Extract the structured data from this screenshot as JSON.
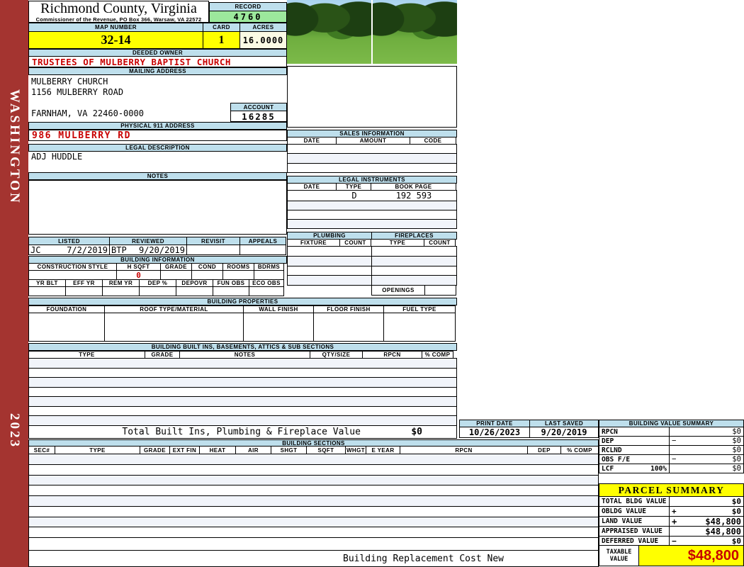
{
  "sidebar": {
    "county_vertical": "WASHINGTON",
    "year": "2023"
  },
  "colors": {
    "sidebar_maroon": "#A43430",
    "header_blue": "#BEDFEC",
    "record_green": "#9CE89C",
    "accent_yellow": "#FFFF00",
    "acres_cream": "#FAFAE4",
    "alert_red": "#C80000"
  },
  "header": {
    "title": "Richmond County, Virginia",
    "subtitle": "Commissioner of the Revenue, PO Box 366, Warsaw, VA 22572",
    "record_label": "RECORD",
    "record_value": "4760",
    "map_number_label": "MAP NUMBER",
    "map_number_value": "32-14",
    "card_label": "CARD",
    "card_value": "1",
    "acres_label": "ACRES",
    "acres_value": "16.0000"
  },
  "owner": {
    "deeded_owner_label": "DEEDED OWNER",
    "deeded_owner": "TRUSTEES OF MULBERRY BAPTIST CHURCH",
    "mailing_address_label": "MAILING ADDRESS",
    "mailing_lines": [
      "MULBERRY CHURCH",
      "1156 MULBERRY ROAD",
      "",
      "FARNHAM, VA 22460-0000"
    ],
    "account_label": "ACCOUNT",
    "account_value": "16285",
    "physical_address_label": "PHYSICAL 911 ADDRESS",
    "physical_address": "986 MULBERRY RD",
    "legal_description_label": "LEGAL DESCRIPTION",
    "legal_description": "ADJ HUDDLE",
    "notes_label": "NOTES",
    "notes": ""
  },
  "review": {
    "listed_label": "LISTED",
    "reviewed_label": "REVIEWED",
    "revisit_label": "REVISIT",
    "appeals_label": "APPEALS",
    "listed_by": "JC",
    "listed_date": "7/2/2019",
    "reviewed_by": "BTP",
    "reviewed_date": "9/20/2019",
    "revisit": "",
    "appeals": ""
  },
  "building_information": {
    "title": "BUILDING INFORMATION",
    "row1_headers": [
      "CONSTRUCTION STYLE",
      "H SQFT",
      "GRADE",
      "COND",
      "ROOMS",
      "BDRMS"
    ],
    "h_sqft_value": "0",
    "row2_headers": [
      "YR BLT",
      "EFF YR",
      "REM YR",
      "DEP %",
      "DEPOVR",
      "FUN OBS",
      "ECO OBS"
    ]
  },
  "building_properties": {
    "title": "BUILDING PROPERTIES",
    "headers": [
      "FOUNDATION",
      "ROOF TYPE/MATERIAL",
      "WALL FINISH",
      "FLOOR FINISH",
      "FUEL TYPE"
    ]
  },
  "built_ins": {
    "title": "BUILDING BUILT INS, BASEMENTS, ATTICS & SUB SECTIONS",
    "headers": [
      "TYPE",
      "GRADE",
      "NOTES",
      "QTY/SIZE",
      "RPCN",
      "% COMP"
    ],
    "total_label": "Total Built Ins, Plumbing & Fireplace Value",
    "total_value": "$0"
  },
  "sales_information": {
    "title": "SALES INFORMATION",
    "headers": [
      "DATE",
      "AMOUNT",
      "CODE"
    ]
  },
  "legal_instruments": {
    "title": "LEGAL INSTRUMENTS",
    "headers": [
      "DATE",
      "TYPE",
      "BOOK PAGE"
    ],
    "row1": {
      "date": "",
      "type": "D",
      "book_page": "192 593"
    }
  },
  "plumbing": {
    "title": "PLUMBING",
    "headers": [
      "FIXTURE",
      "COUNT"
    ]
  },
  "fireplaces": {
    "title": "FIREPLACES",
    "headers": [
      "TYPE",
      "COUNT"
    ],
    "openings_label": "OPENINGS"
  },
  "print_info": {
    "print_date_label": "PRINT DATE",
    "print_date": "10/26/2023",
    "last_saved_label": "LAST SAVED",
    "last_saved": "9/20/2019"
  },
  "building_sections": {
    "title": "BUILDING SECTIONS",
    "headers": [
      "SEC#",
      "TYPE",
      "GRADE",
      "EXT FIN",
      "HEAT",
      "AIR",
      "SHGT",
      "SQFT",
      "WHGT",
      "E YEAR",
      "RPCN",
      "DEP",
      "% COMP"
    ]
  },
  "building_value_summary": {
    "title": "BUILDING VALUE SUMMARY",
    "rows": [
      {
        "label": "RPCN",
        "op": "",
        "value": "$0"
      },
      {
        "label": "DEP",
        "op": "−",
        "value": "$0"
      },
      {
        "label": "RCLND",
        "op": "",
        "value": "$0"
      },
      {
        "label": "OBS F/E",
        "op": "−",
        "value": "$0"
      },
      {
        "label": "LCF",
        "pct": "100%",
        "op": "",
        "value": "$0"
      }
    ]
  },
  "parcel_summary": {
    "title": "PARCEL SUMMARY",
    "rows": [
      {
        "label": "TOTAL BLDG VALUE",
        "op": "",
        "value": "$0"
      },
      {
        "label": "OBLDG VALUE",
        "op": "+",
        "value": "$0"
      },
      {
        "label": "LAND VALUE",
        "op": "+",
        "value": "$48,800"
      },
      {
        "label": "APPRAISED VALUE",
        "op": "",
        "value": "$48,800"
      },
      {
        "label": "DEFERRED VALUE",
        "op": "−",
        "value": "$0"
      }
    ],
    "taxable_label_line1": "TAXABLE",
    "taxable_label_line2": "VALUE",
    "taxable_value": "$48,800"
  },
  "footer": {
    "replacement_cost_label": "Building Replacement Cost New"
  }
}
